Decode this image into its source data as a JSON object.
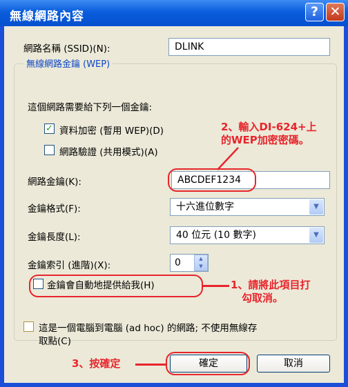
{
  "window": {
    "title": "無線網路內容",
    "help_label": "?",
    "close_label": "✕"
  },
  "ssid": {
    "label": "網路名稱 (SSID)(N):",
    "value": "DLINK"
  },
  "group": {
    "title": "無線網路金鑰 (WEP)"
  },
  "key_required_text": "這個網路需要給下列一個金鑰:",
  "options": {
    "data_encryption": {
      "label": "資料加密 (暫用 WEP)(D)",
      "checked": true
    },
    "network_auth": {
      "label": "網路驗證 (共用模式)(A)",
      "checked": false
    }
  },
  "network_key": {
    "label": "網路金鑰(K):",
    "value": "ABCDEF1234"
  },
  "key_format": {
    "label": "金鑰格式(F):",
    "value": "十六進位數字"
  },
  "key_length": {
    "label": "金鑰長度(L):",
    "value": "40 位元 (10 數字)"
  },
  "key_index": {
    "label": "金鑰索引 (進階)(X):",
    "value": "0"
  },
  "auto_key": {
    "label": "金鑰會自動地提供給我(H)",
    "checked": false
  },
  "adhoc": {
    "label_line1": "這是一個電腦到電腦 (ad hoc) 的網路; 不使用無線存",
    "label_line2": "取點(C)",
    "checked": false
  },
  "buttons": {
    "ok": "確定",
    "cancel": "取消"
  },
  "annotations": {
    "step2_line1": "2、輸入DI-624+上",
    "step2_line2": "的WEP加密密碼。",
    "step1_line1": "1、請將此項目打",
    "step1_line2": "勾取消。",
    "step3": "3、按確定",
    "color": "#e8242c"
  },
  "icons": {
    "checkmark": "✓",
    "dropdown": "▼",
    "spin_up": "▲",
    "spin_down": "▼"
  }
}
